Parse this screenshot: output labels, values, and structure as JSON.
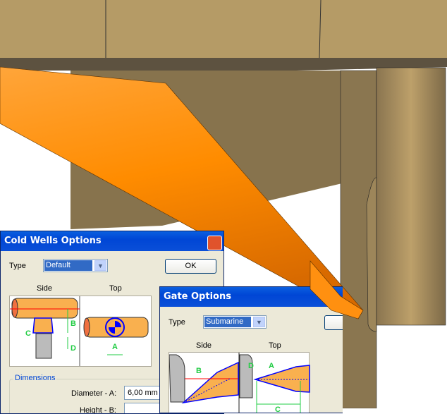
{
  "cold_wells": {
    "title": "Cold Wells Options",
    "type_label": "Type",
    "type_value": "Default",
    "ok_label": "OK",
    "side_label": "Side",
    "top_label": "Top",
    "diagram_labels": {
      "a": "A",
      "b": "B",
      "c": "C",
      "d": "D"
    },
    "dimensions_label": "Dimensions",
    "diameter_label": "Diameter - A:",
    "diameter_value": "6,00 mm",
    "height_label": "Height - B:"
  },
  "gate": {
    "title": "Gate Options",
    "type_label": "Type",
    "type_value": "Submarine",
    "side_label": "Side",
    "top_label": "Top",
    "diagram_labels": {
      "a": "A",
      "b": "B",
      "c": "C",
      "d": "D"
    }
  }
}
